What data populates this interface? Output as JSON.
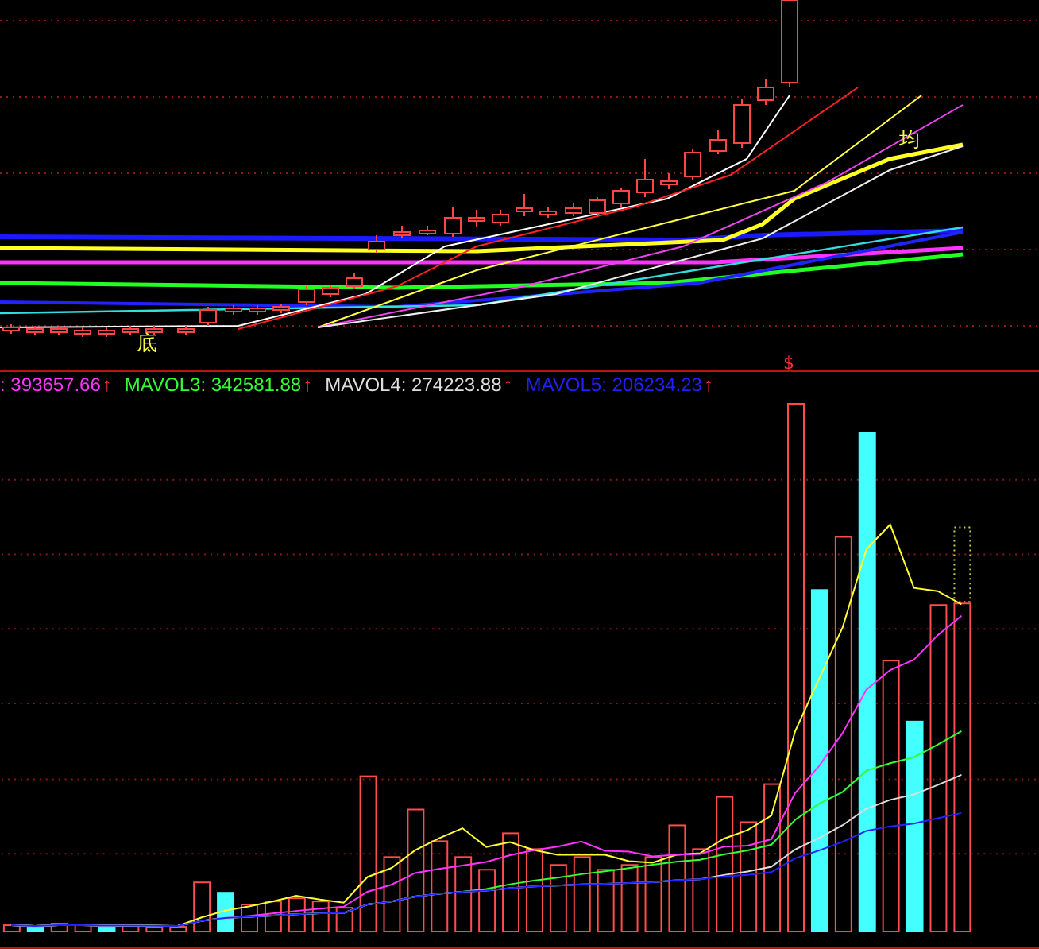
{
  "price_panel": {
    "markers": [
      {
        "kind": "bottom",
        "text": "底"
      },
      {
        "kind": "average",
        "text": "均"
      },
      {
        "kind": "signal",
        "text": "$"
      }
    ]
  },
  "volume_legend": [
    {
      "text": ": 393657.66",
      "color": "#ff33ff",
      "trend": "↑"
    },
    {
      "text": "MAVOL3: 342581.88",
      "color": "#33ff33",
      "trend": "↑"
    },
    {
      "text": "MAVOL4: 274223.88",
      "color": "#dddddd",
      "trend": "↑"
    },
    {
      "text": "MAVOL5: 206234.23",
      "color": "#2020ff",
      "trend": "↑"
    }
  ]
}
